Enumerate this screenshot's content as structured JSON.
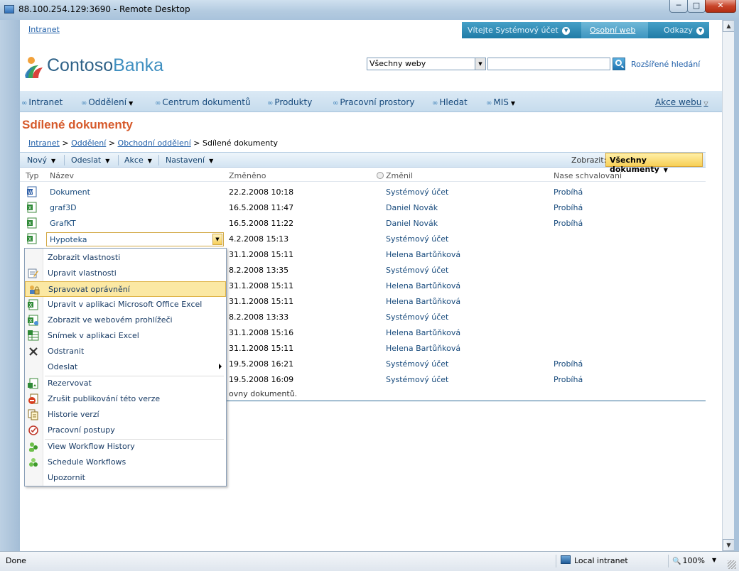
{
  "window": {
    "title": "88.100.254.129:3690 - Remote Desktop",
    "min_glyph": "─",
    "max_glyph": "□",
    "close_glyph": "✕"
  },
  "topbar": {
    "home_link": "Intranet",
    "welcome": "Vítejte Systémový účet",
    "my_site": "Osobní web",
    "links": "Odkazy"
  },
  "logo": {
    "part1": "Contoso",
    "part2": "Banka"
  },
  "search": {
    "scope": "Všechny weby",
    "query": "",
    "advanced": "Rozšířené hledání"
  },
  "nav": {
    "items": [
      {
        "label": "Intranet",
        "dropdown": false
      },
      {
        "label": "Oddělení",
        "dropdown": true
      },
      {
        "label": "Centrum dokumentů",
        "dropdown": false
      },
      {
        "label": "Produkty",
        "dropdown": false
      },
      {
        "label": "Pracovní prostory",
        "dropdown": false
      },
      {
        "label": "Hledat",
        "dropdown": false
      },
      {
        "label": "MIS",
        "dropdown": true
      }
    ],
    "site_actions": "Akce webu"
  },
  "page": {
    "title": "Sdílené dokumenty",
    "breadcrumb": [
      "Intranet",
      "Oddělení",
      "Obchodní oddělení",
      "Sdílené dokumenty"
    ],
    "breadcrumb_sep": ">"
  },
  "toolbar": {
    "new": "Nový",
    "upload": "Odeslat",
    "actions": "Akce",
    "settings": "Nastavení",
    "view_label": "Zobrazit:",
    "view_value": "Všechny dokumenty"
  },
  "table": {
    "headers": {
      "type": "Typ",
      "name": "Název",
      "modified": "Změněno",
      "modified_by": "Změnil",
      "approval": "Nase schvalovani"
    },
    "rows": [
      {
        "name": "Dokument",
        "modified": "22.2.2008 10:18",
        "modified_by": "Systémový účet",
        "status": "Probíhá",
        "icon": "word-doc-icon"
      },
      {
        "name": "graf3D",
        "modified": "16.5.2008 11:47",
        "modified_by": "Daniel Novák",
        "status": "Probíhá",
        "icon": "excel-doc-icon"
      },
      {
        "name": "GrafKT",
        "modified": "16.5.2008 11:22",
        "modified_by": "Daniel Novák",
        "status": "Probíhá",
        "icon": "excel-doc-icon"
      },
      {
        "name": "Hypoteka",
        "modified": "4.2.2008 15:13",
        "modified_by": "Systémový účet",
        "status": "",
        "icon": "excel-doc-icon"
      },
      {
        "name": "",
        "modified": "31.1.2008 15:11",
        "modified_by": "Helena Bartůňková",
        "status": "",
        "icon": ""
      },
      {
        "name": "",
        "modified": "8.2.2008 13:35",
        "modified_by": "Systémový účet",
        "status": "",
        "icon": ""
      },
      {
        "name": "",
        "modified": "31.1.2008 15:11",
        "modified_by": "Helena Bartůňková",
        "status": "",
        "icon": ""
      },
      {
        "name": "",
        "modified": "31.1.2008 15:11",
        "modified_by": "Helena Bartůňková",
        "status": "",
        "icon": ""
      },
      {
        "name": "",
        "modified": "8.2.2008 13:33",
        "modified_by": "Systémový účet",
        "status": "",
        "icon": ""
      },
      {
        "name": "",
        "modified": "31.1.2008 15:16",
        "modified_by": "Helena Bartůňková",
        "status": "",
        "icon": ""
      },
      {
        "name": "",
        "modified": "31.1.2008 15:11",
        "modified_by": "Helena Bartůňková",
        "status": "",
        "icon": ""
      },
      {
        "name": "",
        "modified": "19.5.2008 16:21",
        "modified_by": "Systémový účet",
        "status": "Probíhá",
        "icon": ""
      },
      {
        "name": "",
        "modified": "19.5.2008 16:09",
        "modified_by": "Systémový účet",
        "status": "Probíhá",
        "icon": ""
      }
    ],
    "footer_fragment": "ovny dokumentů."
  },
  "context_menu": {
    "items": [
      {
        "label": "Zobrazit vlastnosti",
        "icon": "",
        "highlighted": false,
        "submenu": false
      },
      {
        "label": "Upravit vlastnosti",
        "icon": "edit-properties-icon",
        "highlighted": false,
        "submenu": false
      },
      {
        "label": "Spravovat oprávnění",
        "icon": "permissions-icon",
        "highlighted": true,
        "submenu": false
      },
      {
        "label": "Upravit v aplikaci Microsoft Office Excel",
        "icon": "excel-edit-icon",
        "highlighted": false,
        "submenu": false
      },
      {
        "label": "Zobrazit ve webovém prohlížeči",
        "icon": "excel-web-icon",
        "highlighted": false,
        "submenu": false
      },
      {
        "label": "Snímek v aplikaci Excel",
        "icon": "excel-snapshot-icon",
        "highlighted": false,
        "submenu": false
      },
      {
        "label": "Odstranit",
        "icon": "delete-icon",
        "highlighted": false,
        "submenu": false
      },
      {
        "label": "Odeslat",
        "icon": "",
        "highlighted": false,
        "submenu": true
      },
      {
        "label": "Rezervovat",
        "icon": "checkout-icon",
        "highlighted": false,
        "submenu": false
      },
      {
        "label": "Zrušit publikování této verze",
        "icon": "unpublish-icon",
        "highlighted": false,
        "submenu": false
      },
      {
        "label": "Historie verzí",
        "icon": "version-history-icon",
        "highlighted": false,
        "submenu": false
      },
      {
        "label": "Pracovní postupy",
        "icon": "workflows-icon",
        "highlighted": false,
        "submenu": false
      },
      {
        "label": "View Workflow History",
        "icon": "workflow-history-icon",
        "highlighted": false,
        "submenu": false
      },
      {
        "label": "Schedule Workflows",
        "icon": "schedule-workflows-icon",
        "highlighted": false,
        "submenu": false
      },
      {
        "label": "Upozornit",
        "icon": "",
        "highlighted": false,
        "submenu": false
      }
    ]
  },
  "statusbar": {
    "status": "Done",
    "zone": "Local intranet",
    "zoom": "100%",
    "zoom_icon": "🔍"
  },
  "colors": {
    "title_orange": "#d65a2b",
    "link_blue": "#1f5ea8",
    "highlight_yellow": "#fbe8a3",
    "welcome_bar": "#2d88b4"
  }
}
